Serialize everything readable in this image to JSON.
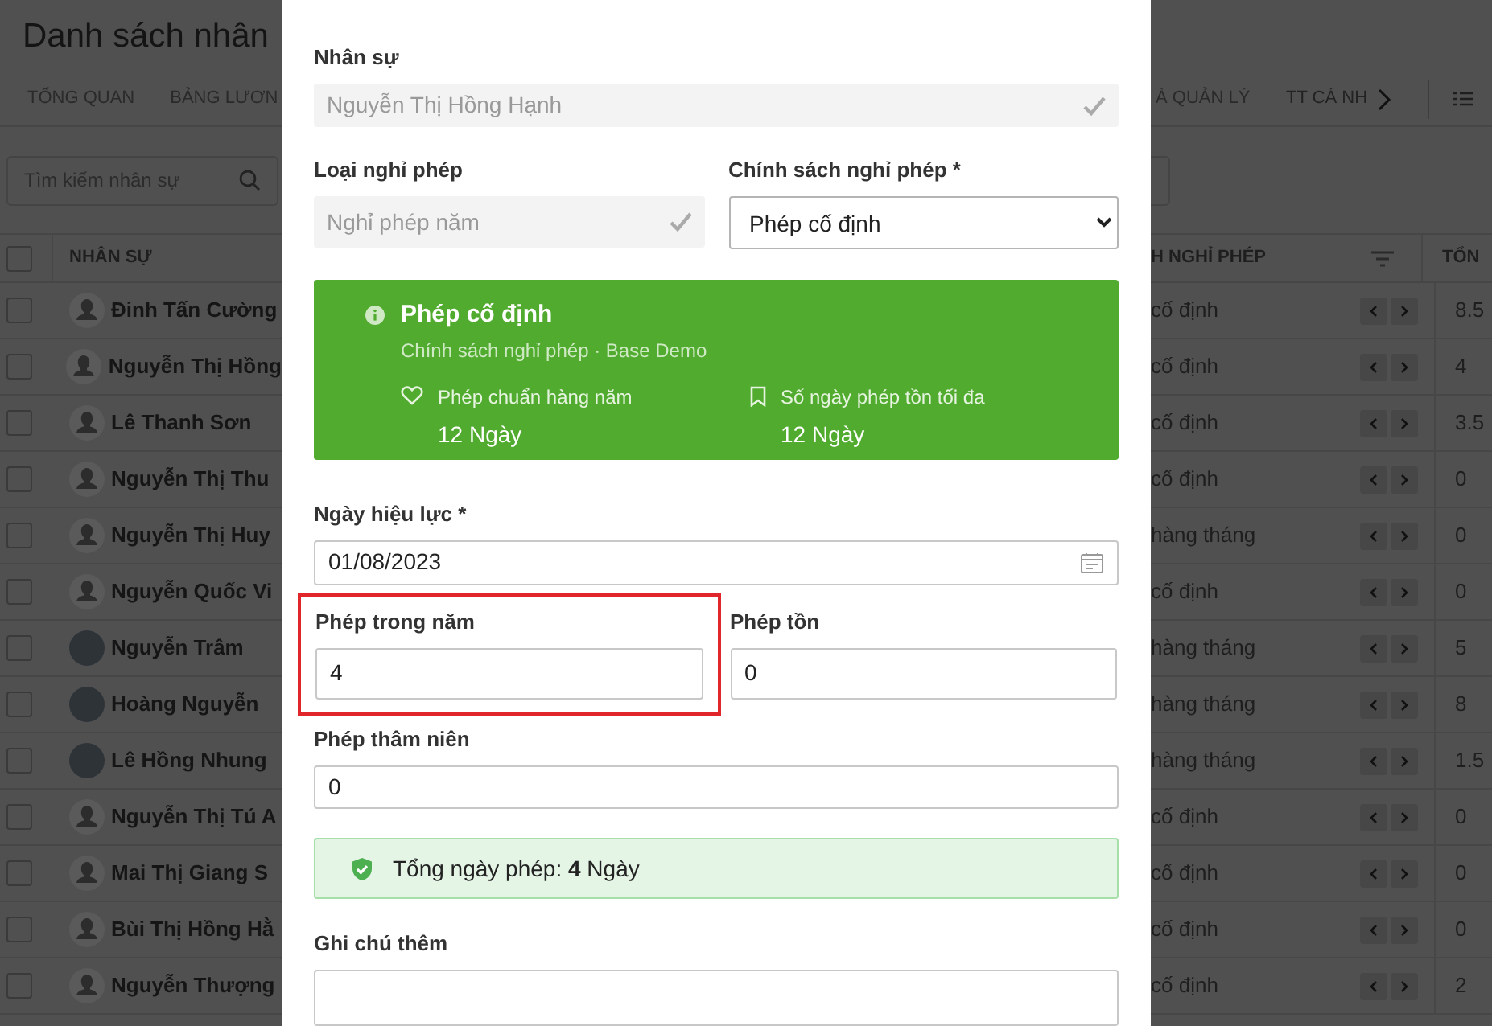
{
  "page": {
    "title": "Danh sách nhân",
    "tabs_left": [
      {
        "label": "TỔNG QUAN"
      },
      {
        "label": "BẢNG LƯƠN"
      }
    ],
    "tabs_right": [
      {
        "label": "À QUẢN LÝ"
      },
      {
        "label": "TT CÁ NH"
      }
    ],
    "search": {
      "placeholder": "Tìm kiếm nhân sự"
    },
    "columns": {
      "left": "NHÂN SỰ",
      "right": "H NGHỈ PHÉP",
      "far": "TỔN"
    },
    "header_checked": false,
    "rows": [
      {
        "name": "Đinh Tấn Cường",
        "kind": "silhouette",
        "policy": "cố định",
        "total": "8.5",
        "checked": false
      },
      {
        "name": "Nguyễn Thị Hồng",
        "kind": "silhouette",
        "policy": "cố định",
        "total": "4",
        "checked": false
      },
      {
        "name": "Lê Thanh Sơn",
        "kind": "silhouette",
        "policy": "cố định",
        "total": "3.5",
        "checked": false
      },
      {
        "name": "Nguyễn Thị Thu",
        "kind": "silhouette",
        "policy": "cố định",
        "total": "0",
        "checked": false
      },
      {
        "name": "Nguyễn Thị Huy",
        "kind": "silhouette",
        "policy": "hàng tháng",
        "total": "0",
        "checked": false
      },
      {
        "name": "Nguyễn Quốc Vi",
        "kind": "silhouette",
        "policy": "cố định",
        "total": "0",
        "checked": false
      },
      {
        "name": "Nguyễn Trâm",
        "kind": "photo",
        "policy": "hàng tháng",
        "total": "5",
        "checked": false
      },
      {
        "name": "Hoàng Nguyễn",
        "kind": "photo",
        "policy": "hàng tháng",
        "total": "8",
        "checked": false
      },
      {
        "name": "Lê Hồng Nhung",
        "kind": "photo",
        "policy": "hàng tháng",
        "total": "1.5",
        "checked": false
      },
      {
        "name": "Nguyễn Thị Tú A",
        "kind": "silhouette",
        "policy": "cố định",
        "total": "0",
        "checked": false
      },
      {
        "name": "Mai Thị Giang S",
        "kind": "silhouette",
        "policy": "cố định",
        "total": "0",
        "checked": false
      },
      {
        "name": "Bùi Thị Hồng Hằ",
        "kind": "silhouette",
        "policy": "cố định",
        "total": "0",
        "checked": false
      },
      {
        "name": "Nguyễn Thượng",
        "kind": "silhouette",
        "policy": "cố định",
        "total": "2",
        "checked": false
      }
    ]
  },
  "modal": {
    "employee": {
      "label": "Nhân sự",
      "value": "Nguyễn Thị Hồng Hạnh"
    },
    "leave_type": {
      "label": "Loại nghỉ phép",
      "value": "Nghỉ phép năm"
    },
    "policy": {
      "label": "Chính sách nghỉ phép *",
      "value": "Phép cố định"
    },
    "policy_card": {
      "title": "Phép cố định",
      "subtitle": "Chính sách nghỉ phép · Base Demo",
      "stats": [
        {
          "label": "Phép chuẩn hàng năm",
          "value": "12 Ngày"
        },
        {
          "label": "Số ngày phép tồn tối đa",
          "value": "12 Ngày"
        }
      ]
    },
    "effective_date": {
      "label": "Ngày hiệu lực *",
      "value": "01/08/2023"
    },
    "annual": {
      "label": "Phép trong năm",
      "value": "4",
      "highlighted": true
    },
    "carryover": {
      "label": "Phép tồn",
      "value": "0",
      "highlighted": false
    },
    "seniority": {
      "label": "Phép thâm niên",
      "value": "0"
    },
    "total": "Tổng ngày phép: **4** Ngày",
    "note": {
      "label": "Ghi chú thêm"
    }
  }
}
